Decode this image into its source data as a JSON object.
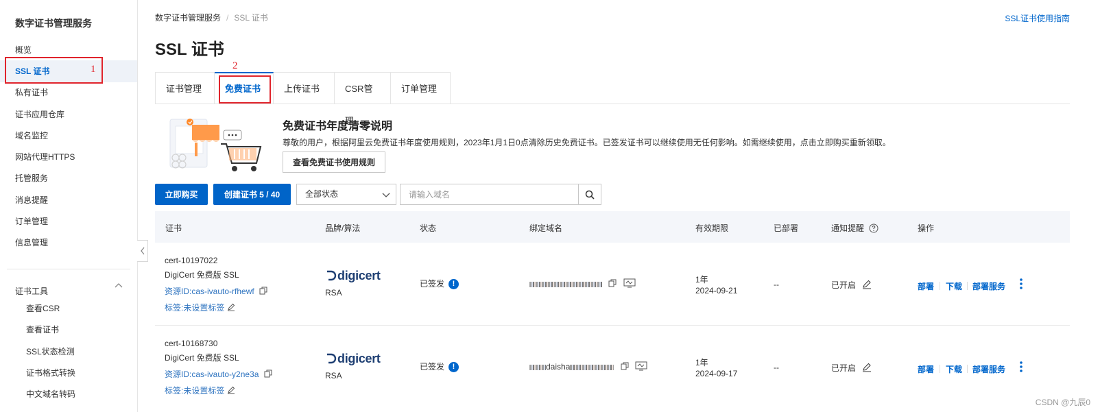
{
  "sidebar": {
    "title": "数字证书管理服务",
    "items": [
      {
        "label": "概览"
      },
      {
        "label": "SSL 证书"
      },
      {
        "label": "私有证书"
      },
      {
        "label": "证书应用仓库"
      },
      {
        "label": "域名监控"
      },
      {
        "label": "网站代理HTTPS"
      },
      {
        "label": "托管服务"
      },
      {
        "label": "消息提醒"
      },
      {
        "label": "订单管理"
      },
      {
        "label": "信息管理"
      }
    ],
    "tools_section": "证书工具",
    "tools": [
      {
        "label": "查看CSR"
      },
      {
        "label": "查看证书"
      },
      {
        "label": "SSL状态检测"
      },
      {
        "label": "证书格式转换"
      },
      {
        "label": "中文域名转码"
      }
    ]
  },
  "annotations": {
    "one": "1",
    "two": "2"
  },
  "breadcrumb": {
    "root": "数字证书管理服务",
    "sep": "/",
    "current": "SSL 证书"
  },
  "guide_link": "SSL证书使用指南",
  "page_title": "SSL 证书",
  "tabs": [
    {
      "label": "证书管理"
    },
    {
      "label": "免费证书"
    },
    {
      "label": "上传证书"
    },
    {
      "label": "CSR管理"
    },
    {
      "label": "订单管理"
    }
  ],
  "banner": {
    "title": "免费证书年度清零说明",
    "desc": "尊敬的用户，根据阿里云免费证书年度使用规则，2023年1月1日0点清除历史免费证书。已签发证书可以继续使用无任何影响。如需继续使用，点击立即购买重新领取。",
    "button": "查看免费证书使用规则"
  },
  "toolbar": {
    "buy": "立即购买",
    "create": "创建证书 5 / 40",
    "status_select": "全部状态",
    "search_placeholder": "请输入域名"
  },
  "table": {
    "headers": {
      "cert": "证书",
      "brand": "品牌/算法",
      "status": "状态",
      "domain": "绑定域名",
      "validity": "有效期限",
      "deployed": "已部署",
      "notify": "通知提醒",
      "ops": "操作"
    },
    "rows": [
      {
        "id": "cert-10197022",
        "name": "DigiCert 免费版 SSL",
        "resource": "资源ID:cas-ivauto-rfhewf",
        "tag": "标签:未设置标签",
        "brand": "digicert",
        "algo": "RSA",
        "status": "已签发",
        "period": "1年",
        "expire": "2024-09-21",
        "deployed": "--",
        "notify": "已开启",
        "op_deploy": "部署",
        "op_download": "下载",
        "op_service": "部署服务"
      },
      {
        "id": "cert-10168730",
        "name": "DigiCert 免费版 SSL",
        "resource": "资源ID:cas-ivauto-y2ne3a",
        "tag": "标签:未设置标签",
        "brand": "digicert",
        "algo": "RSA",
        "status": "已签发",
        "domain_partial": "daisha",
        "period": "1年",
        "expire": "2024-09-17",
        "deployed": "--",
        "notify": "已开启",
        "op_deploy": "部署",
        "op_download": "下载",
        "op_service": "部署服务"
      }
    ]
  },
  "watermark": "CSDN @九辰0",
  "colors": {
    "accent": "#0064c8",
    "annotation": "#e0242c",
    "active_bg": "#eef2f8"
  }
}
